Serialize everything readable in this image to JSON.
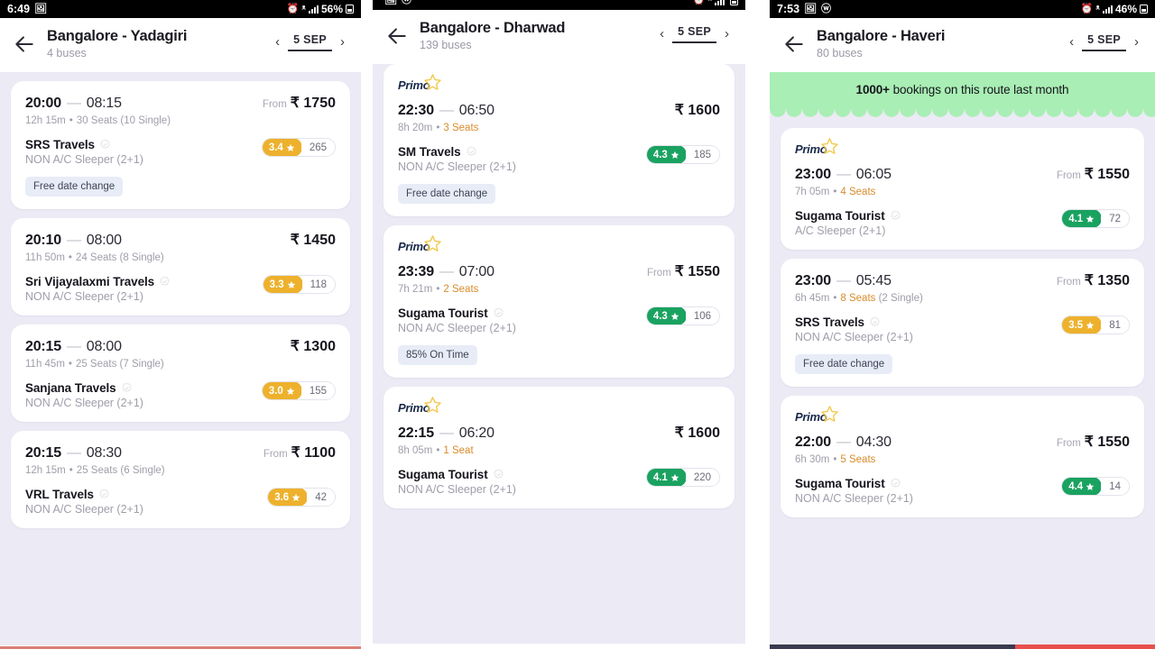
{
  "panels": [
    {
      "status_bar": {
        "time": "6:49",
        "battery": "56%",
        "clipped": false
      },
      "header": {
        "route": "Bangalore - Yadagiri",
        "bus_count": "4 buses",
        "date": "5 SEP",
        "prev_icon": "chevron-left-icon",
        "next_icon": "chevron-right-icon",
        "back_icon": "back-arrow-icon"
      },
      "promo": null,
      "cards": [
        {
          "primo": false,
          "departure": "20:00",
          "arrival": "08:15",
          "price": "₹ 1750",
          "price_prefix": "From",
          "duration": "12h 15m",
          "seats": "30 Seats",
          "seats_note": "(10 Single)",
          "seats_low": false,
          "operator": "SRS Travels",
          "bus_type": "NON A/C Sleeper (2+1)",
          "rating": "3.4",
          "rating_count": "265",
          "rating_color": "amber",
          "tag": "Free date change"
        },
        {
          "primo": false,
          "departure": "20:10",
          "arrival": "08:00",
          "price": "₹ 1450",
          "price_prefix": "",
          "duration": "11h 50m",
          "seats": "24 Seats",
          "seats_note": "(8 Single)",
          "seats_low": false,
          "operator": "Sri Vijayalaxmi Travels",
          "bus_type": "NON A/C Sleeper (2+1)",
          "rating": "3.3",
          "rating_count": "118",
          "rating_color": "amber",
          "tag": null
        },
        {
          "primo": false,
          "departure": "20:15",
          "arrival": "08:00",
          "price": "₹ 1300",
          "price_prefix": "",
          "duration": "11h 45m",
          "seats": "25 Seats",
          "seats_note": "(7 Single)",
          "seats_low": false,
          "operator": "Sanjana Travels",
          "bus_type": "NON A/C Sleeper (2+1)",
          "rating": "3.0",
          "rating_count": "155",
          "rating_color": "amber",
          "tag": null
        },
        {
          "primo": false,
          "departure": "20:15",
          "arrival": "08:30",
          "price": "₹ 1100",
          "price_prefix": "From",
          "duration": "12h 15m",
          "seats": "25 Seats",
          "seats_note": "(6 Single)",
          "seats_low": false,
          "operator": "VRL Travels",
          "bus_type": "NON A/C Sleeper (2+1)",
          "rating": "3.6",
          "rating_count": "42",
          "rating_color": "amber",
          "tag": null
        }
      ]
    },
    {
      "status_bar": {
        "time": "",
        "battery": "",
        "clipped": true
      },
      "header": {
        "route": "Bangalore - Dharwad",
        "bus_count": "139 buses",
        "date": "5 SEP",
        "prev_icon": "chevron-left-icon",
        "next_icon": "chevron-right-icon",
        "back_icon": "back-arrow-icon"
      },
      "promo": null,
      "cards": [
        {
          "primo": true,
          "departure": "22:30",
          "arrival": "06:50",
          "price": "₹ 1600",
          "price_prefix": "",
          "duration": "8h 20m",
          "seats": "3 Seats",
          "seats_note": "",
          "seats_low": true,
          "operator": "SM Travels",
          "bus_type": "NON A/C Sleeper (2+1)",
          "rating": "4.3",
          "rating_count": "185",
          "rating_color": "green",
          "tag": "Free date change"
        },
        {
          "primo": true,
          "departure": "23:39",
          "arrival": "07:00",
          "price": "₹ 1550",
          "price_prefix": "From",
          "duration": "7h 21m",
          "seats": "2 Seats",
          "seats_note": "",
          "seats_low": true,
          "operator": "Sugama Tourist",
          "bus_type": "NON A/C Sleeper (2+1)",
          "rating": "4.3",
          "rating_count": "106",
          "rating_color": "green",
          "tag": "85% On Time"
        },
        {
          "primo": true,
          "departure": "22:15",
          "arrival": "06:20",
          "price": "₹ 1600",
          "price_prefix": "",
          "duration": "8h 05m",
          "seats": "1 Seat",
          "seats_note": "",
          "seats_low": true,
          "operator": "Sugama Tourist",
          "bus_type": "NON A/C Sleeper (2+1)",
          "rating": "4.1",
          "rating_count": "220",
          "rating_color": "green",
          "tag": null
        }
      ]
    },
    {
      "status_bar": {
        "time": "7:53",
        "battery": "46%",
        "clipped": false
      },
      "header": {
        "route": "Bangalore - Haveri",
        "bus_count": "80 buses",
        "date": "5 SEP",
        "prev_icon": "chevron-left-icon",
        "next_icon": "chevron-right-icon",
        "back_icon": "back-arrow-icon"
      },
      "promo": {
        "highlight": "1000+",
        "text": " bookings on this route last month"
      },
      "cards": [
        {
          "primo": true,
          "departure": "23:00",
          "arrival": "06:05",
          "price": "₹ 1550",
          "price_prefix": "From",
          "duration": "7h 05m",
          "seats": "4 Seats",
          "seats_note": "",
          "seats_low": true,
          "operator": "Sugama Tourist",
          "bus_type": "A/C Sleeper (2+1)",
          "rating": "4.1",
          "rating_count": "72",
          "rating_color": "green",
          "tag": null
        },
        {
          "primo": false,
          "departure": "23:00",
          "arrival": "05:45",
          "price": "₹ 1350",
          "price_prefix": "From",
          "duration": "6h 45m",
          "seats": "8 Seats",
          "seats_note": "(2 Single)",
          "seats_low": true,
          "operator": "SRS Travels",
          "bus_type": "NON A/C Sleeper (2+1)",
          "rating": "3.5",
          "rating_count": "81",
          "rating_color": "amber",
          "tag": "Free date change"
        },
        {
          "primo": true,
          "departure": "22:00",
          "arrival": "04:30",
          "price": "₹ 1550",
          "price_prefix": "From",
          "duration": "6h 30m",
          "seats": "5 Seats",
          "seats_note": "",
          "seats_low": true,
          "operator": "Sugama Tourist",
          "bus_type": "NON A/C Sleeper (2+1)",
          "rating": "4.4",
          "rating_count": "14",
          "rating_color": "green",
          "tag": null
        }
      ]
    }
  ],
  "colors": {
    "page_bg": "#eceaf5",
    "card_bg": "#ffffff",
    "rating_green": "#1aa260",
    "rating_amber": "#edb12c",
    "promo_green": "#a9eeb4",
    "tag_bg": "#e7ecf7",
    "seats_low": "#d98b2b"
  },
  "labels": {
    "primo": "Primo",
    "star_icon": "star-icon",
    "verified_icon": "verified-badge-icon"
  }
}
